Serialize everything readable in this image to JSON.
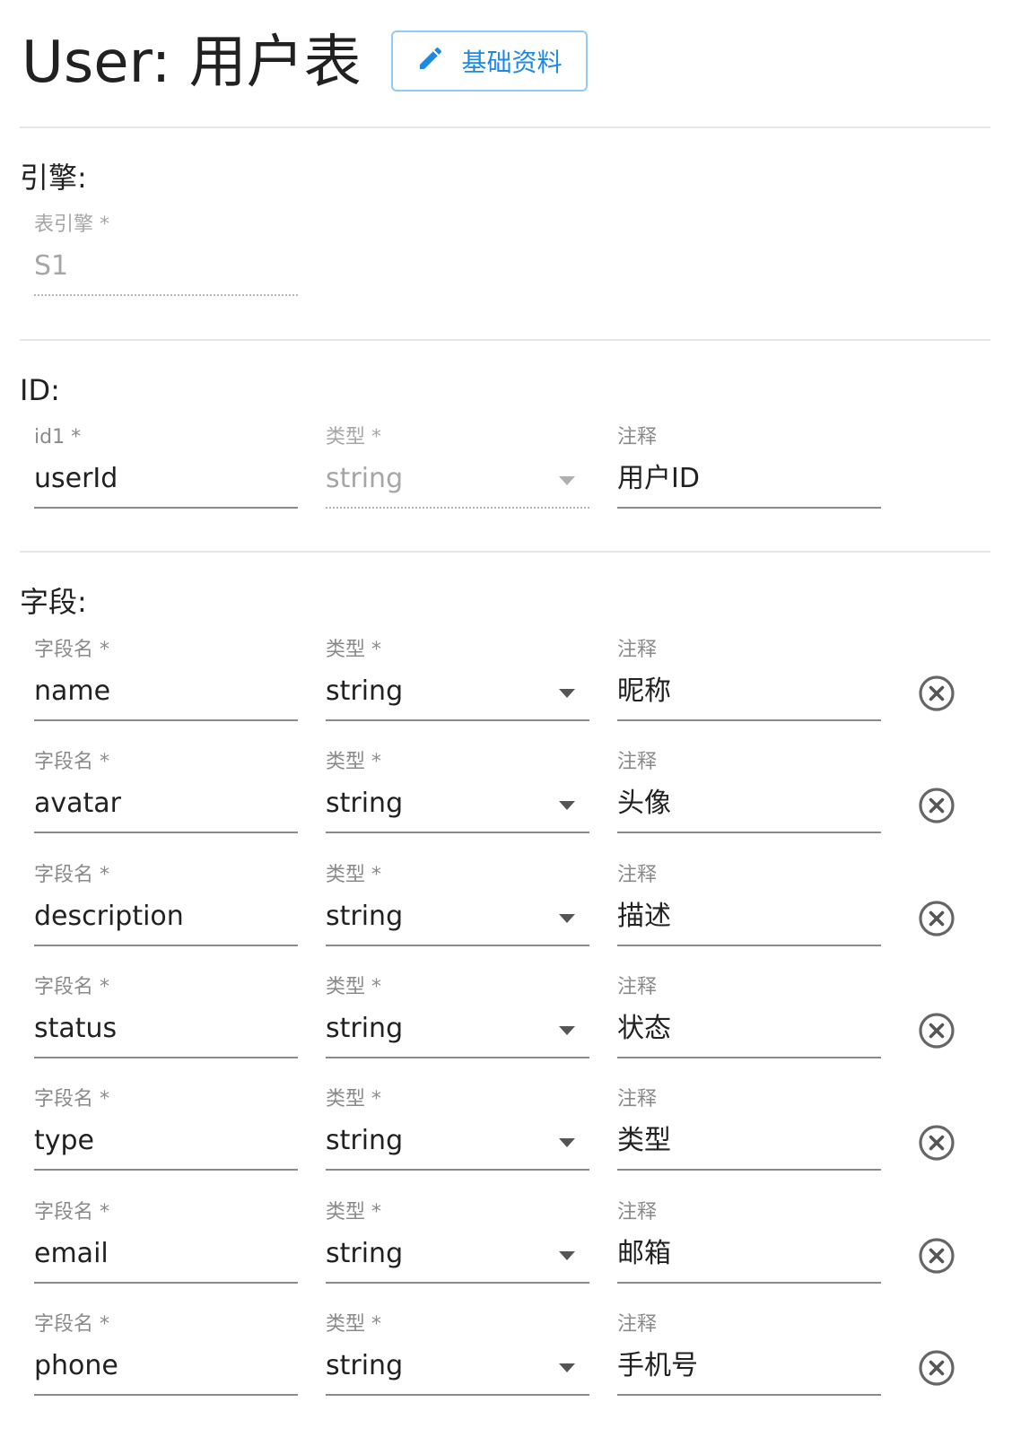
{
  "header": {
    "title": "User: 用户表",
    "edit_button_label": "基础资料"
  },
  "engine": {
    "section_label": "引擎:",
    "field_label": "表引擎 *",
    "value": "S1"
  },
  "id": {
    "section_label": "ID:",
    "name_label": "id1 *",
    "name_value": "userId",
    "type_label": "类型 *",
    "type_value": "string",
    "comment_label": "注释",
    "comment_value": "用户ID"
  },
  "fields": {
    "section_label": "字段:",
    "name_label": "字段名 *",
    "type_label": "类型 *",
    "comment_label": "注释",
    "rows": [
      {
        "name": "name",
        "type": "string",
        "comment": "昵称"
      },
      {
        "name": "avatar",
        "type": "string",
        "comment": "头像"
      },
      {
        "name": "description",
        "type": "string",
        "comment": "描述"
      },
      {
        "name": "status",
        "type": "string",
        "comment": "状态"
      },
      {
        "name": "type",
        "type": "string",
        "comment": "类型"
      },
      {
        "name": "email",
        "type": "string",
        "comment": "邮箱"
      },
      {
        "name": "phone",
        "type": "string",
        "comment": "手机号"
      }
    ]
  },
  "icons": {
    "edit": "pencil-icon",
    "remove": "close-circle-icon",
    "dropdown": "caret-down-icon"
  },
  "colors": {
    "accent": "#1e88e5",
    "accent_border": "#90caf9",
    "label": "#8a8a8a",
    "text": "#212121",
    "disabled": "#a6a6a6"
  }
}
